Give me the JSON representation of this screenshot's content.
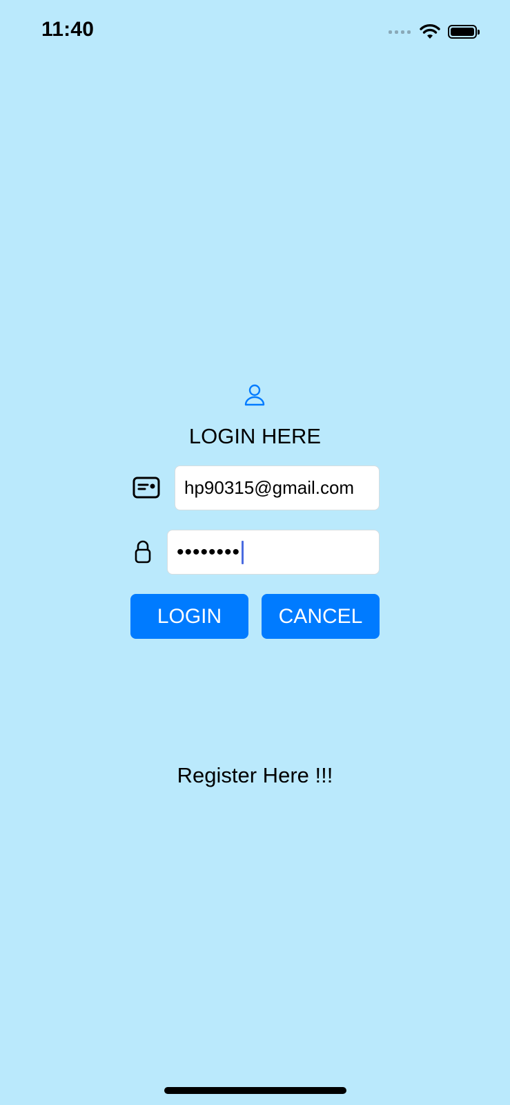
{
  "status_bar": {
    "time": "11:40",
    "icons": [
      "cellular-signal-icon",
      "wifi-icon",
      "battery-icon"
    ]
  },
  "login": {
    "header_icon": "person-icon",
    "title": "LOGIN HERE",
    "email": {
      "icon": "id-card-icon",
      "value": "hp90315@gmail.com"
    },
    "password": {
      "icon": "lock-icon",
      "masked_value": "••••••••"
    },
    "login_button": "LOGIN",
    "cancel_button": "CANCEL",
    "register_link": "Register Here !!!"
  },
  "colors": {
    "background": "#BAE9FC",
    "button": "#007BFF",
    "button_text": "#FFFFFF",
    "accent_icon": "#007BFF"
  }
}
